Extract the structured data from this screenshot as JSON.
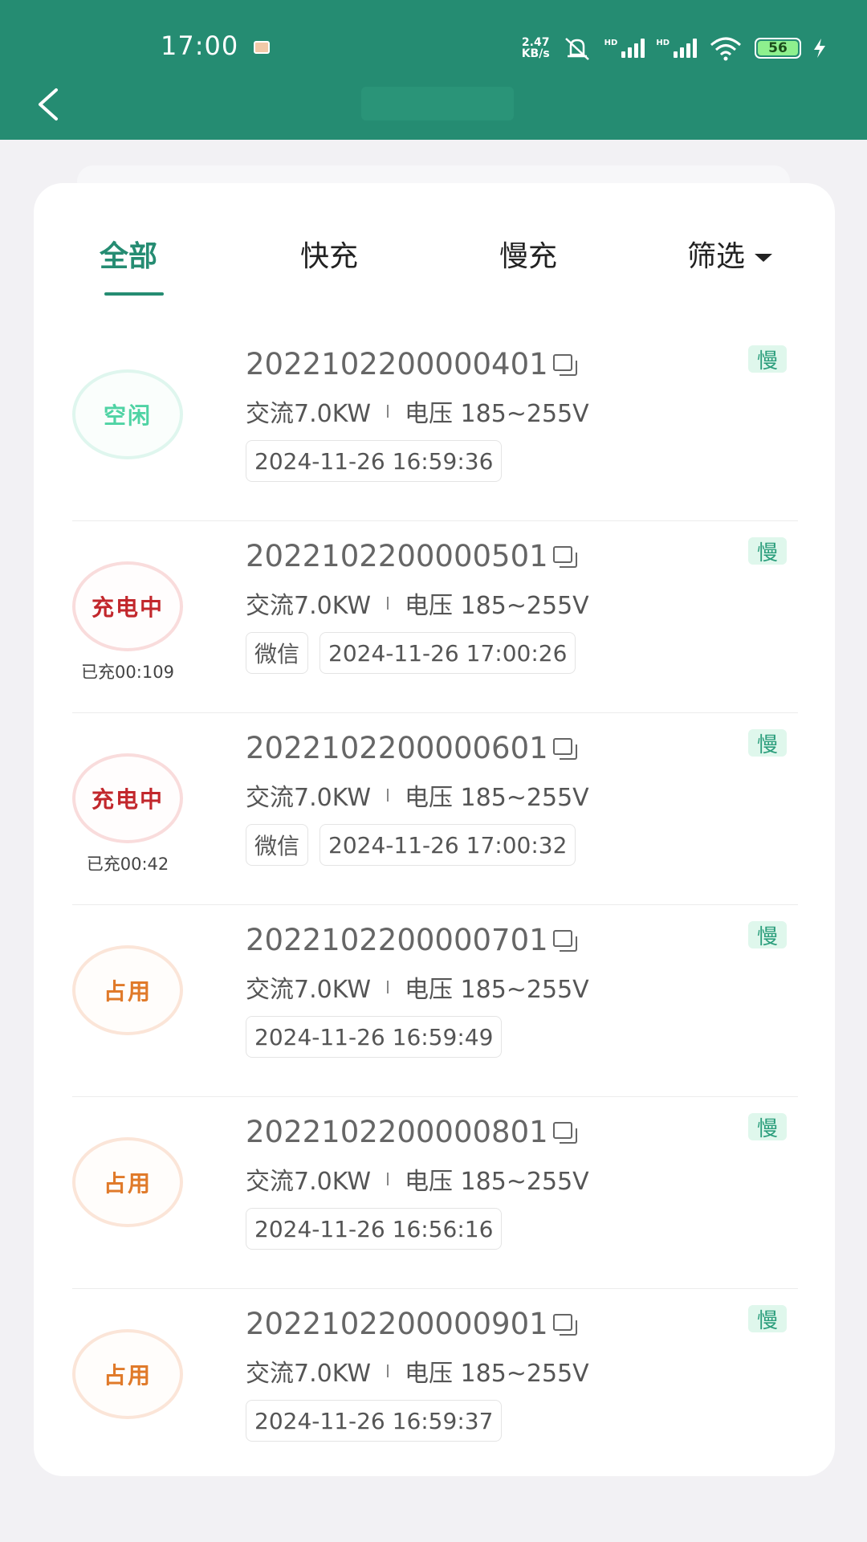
{
  "status_bar": {
    "time": "17:00",
    "net_speed_value": "2.47",
    "net_speed_unit": "KB/s",
    "battery": "56"
  },
  "tabs": [
    {
      "label": "全部"
    },
    {
      "label": "快充"
    },
    {
      "label": "慢充"
    },
    {
      "label": "筛选"
    }
  ],
  "piles": [
    {
      "status": "空闲",
      "status_type": "idle",
      "charged": "",
      "id": "2022102200000401",
      "spec_power": "交流7.0KW",
      "spec_voltage": "电压 185~255V",
      "pay": "",
      "time": "2024-11-26 16:59:36",
      "badge": "慢"
    },
    {
      "status": "充电中",
      "status_type": "charging",
      "charged": "已充00:109",
      "id": "2022102200000501",
      "spec_power": "交流7.0KW",
      "spec_voltage": "电压 185~255V",
      "pay": "微信",
      "time": "2024-11-26 17:00:26",
      "badge": "慢"
    },
    {
      "status": "充电中",
      "status_type": "charging",
      "charged": "已充00:42",
      "id": "2022102200000601",
      "spec_power": "交流7.0KW",
      "spec_voltage": "电压 185~255V",
      "pay": "微信",
      "time": "2024-11-26 17:00:32",
      "badge": "慢"
    },
    {
      "status": "占用",
      "status_type": "occupied",
      "charged": "",
      "id": "2022102200000701",
      "spec_power": "交流7.0KW",
      "spec_voltage": "电压 185~255V",
      "pay": "",
      "time": "2024-11-26 16:59:49",
      "badge": "慢"
    },
    {
      "status": "占用",
      "status_type": "occupied",
      "charged": "",
      "id": "2022102200000801",
      "spec_power": "交流7.0KW",
      "spec_voltage": "电压 185~255V",
      "pay": "",
      "time": "2024-11-26 16:56:16",
      "badge": "慢"
    },
    {
      "status": "占用",
      "status_type": "occupied",
      "charged": "",
      "id": "2022102200000901",
      "spec_power": "交流7.0KW",
      "spec_voltage": "电压 185~255V",
      "pay": "",
      "time": "2024-11-26 16:59:37",
      "badge": "慢"
    }
  ]
}
